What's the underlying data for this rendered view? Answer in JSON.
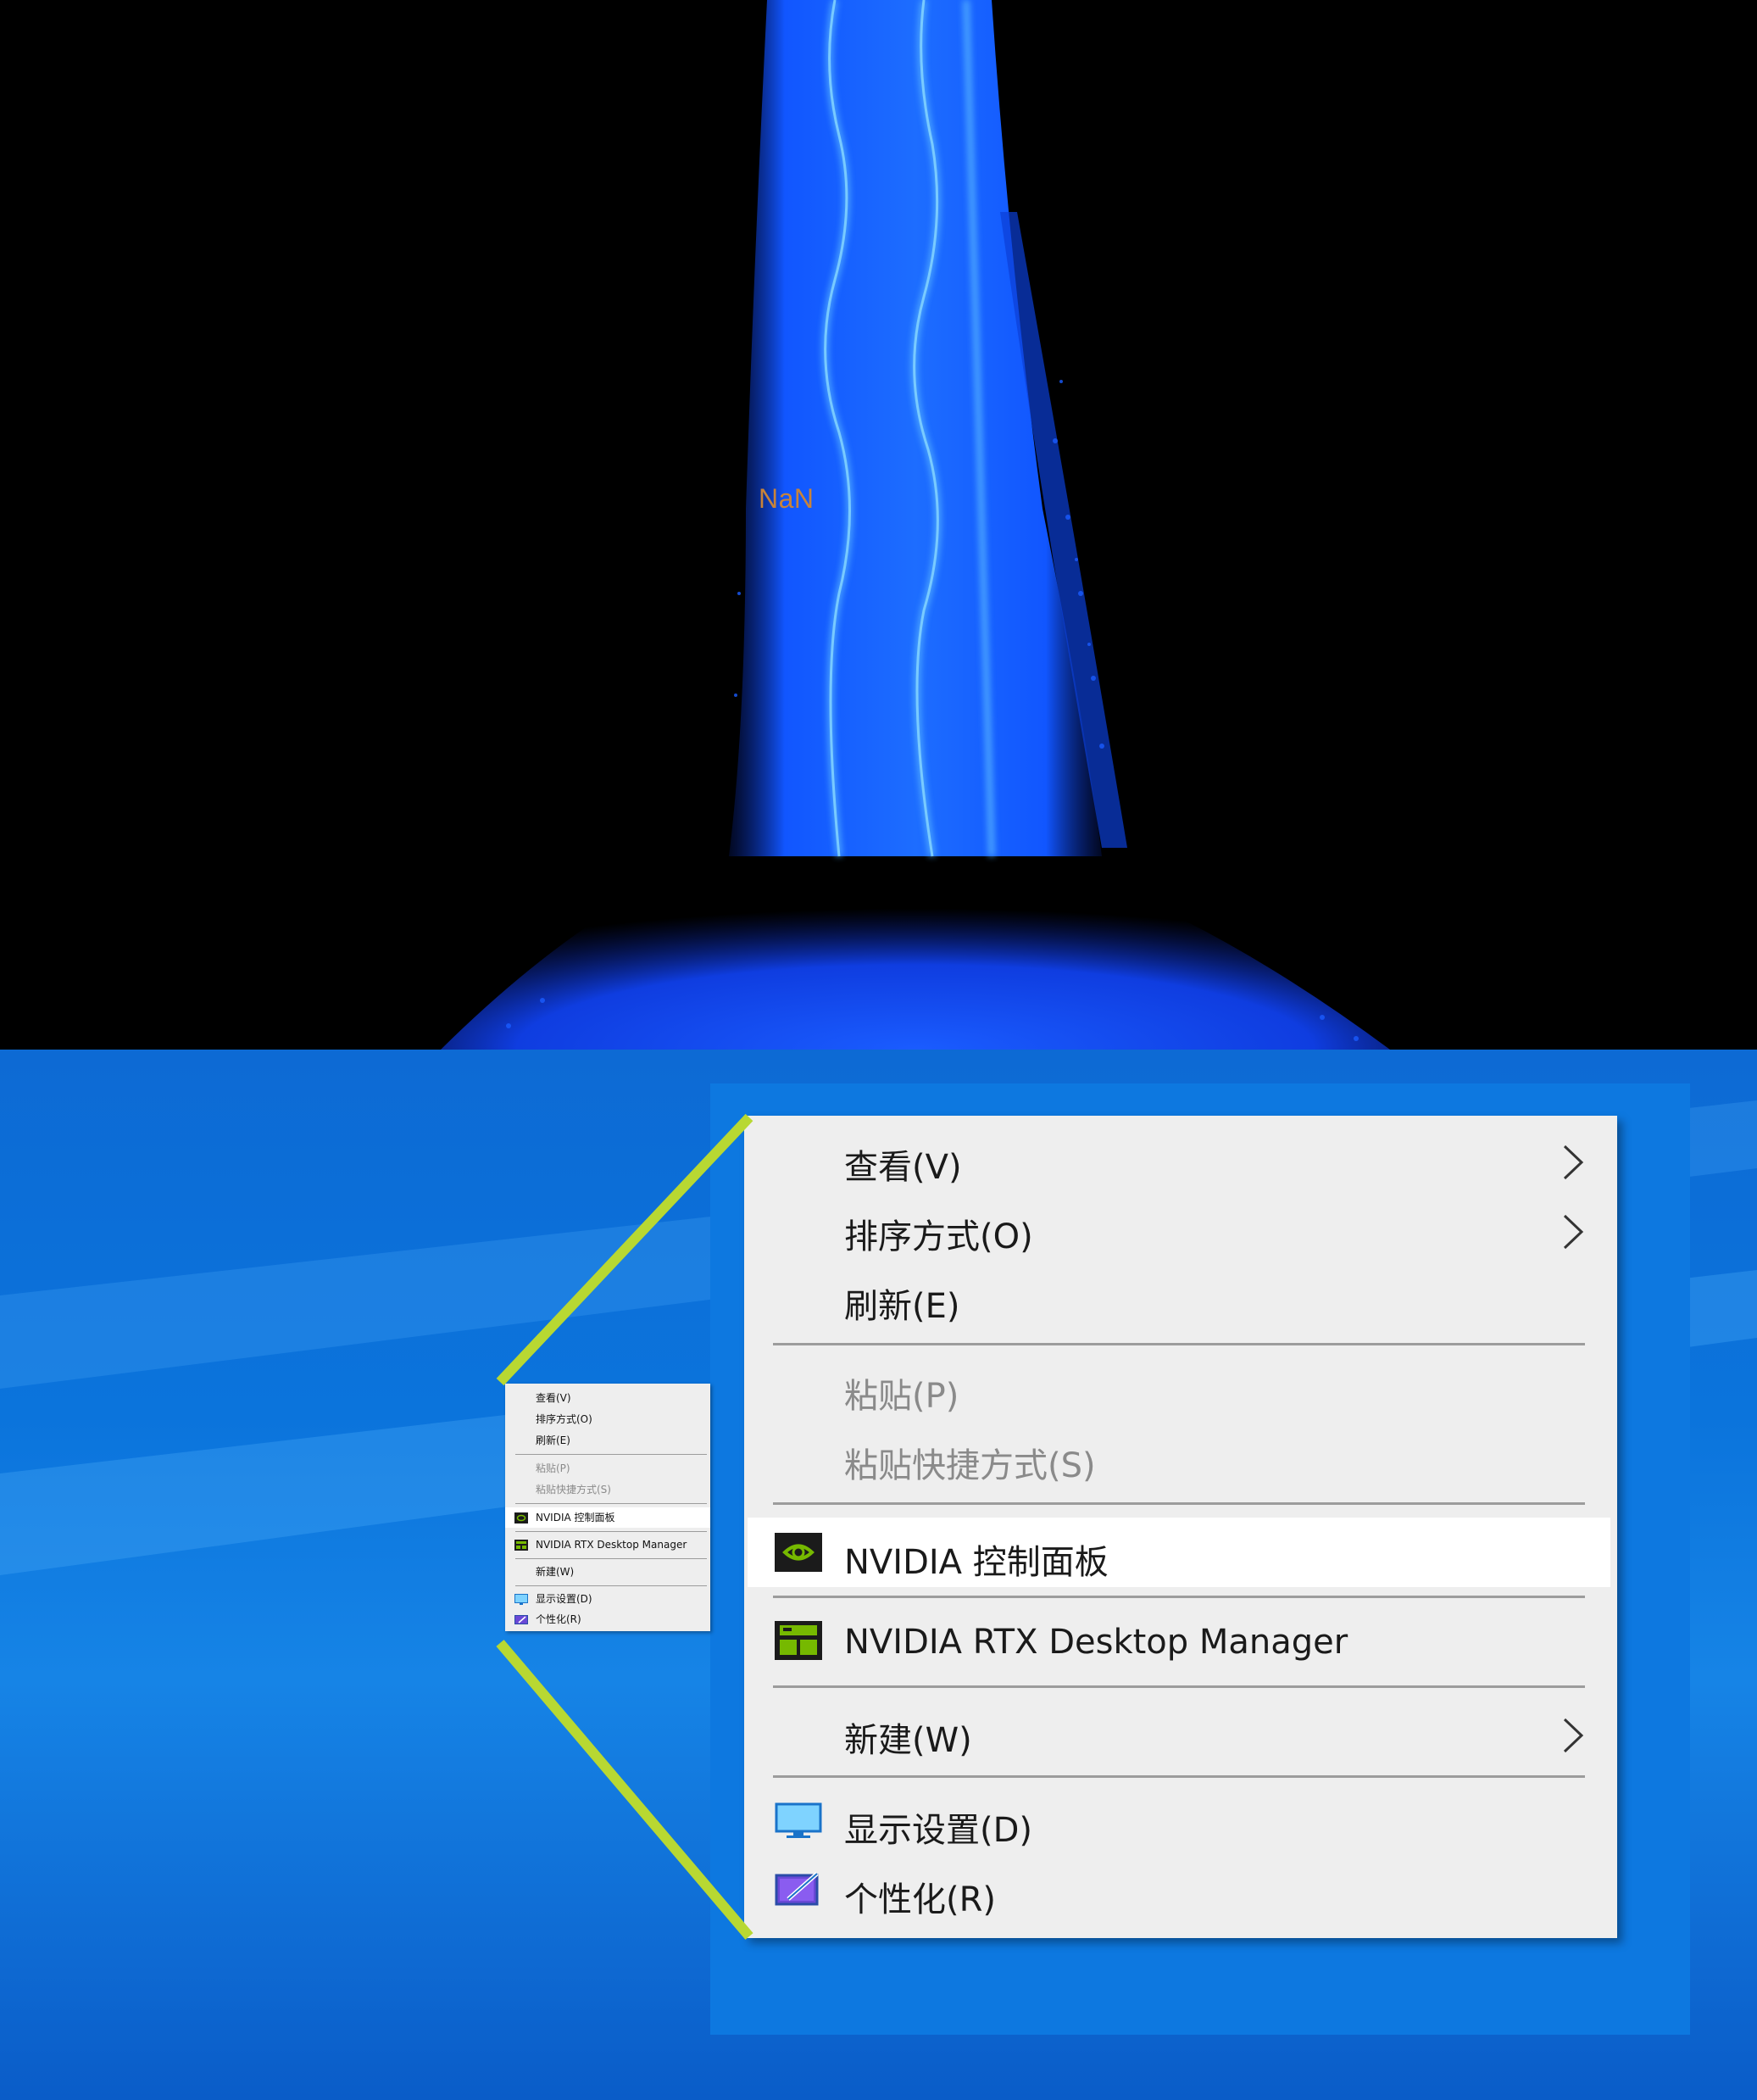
{
  "render": {
    "overlay_text": "NaN",
    "colors": {
      "particles": "#1560ff",
      "highlight": "#5ab8ff",
      "label": "#c8833a"
    }
  },
  "desktop": {
    "colors": {
      "background": "#0b74dc",
      "zoom_lines": "#b8d832"
    }
  },
  "context_menu": {
    "items": [
      {
        "label": "查看(V)",
        "has_submenu": true,
        "icon": ""
      },
      {
        "label": "排序方式(O)",
        "has_submenu": true,
        "icon": ""
      },
      {
        "label": "刷新(E)",
        "has_submenu": false,
        "icon": ""
      },
      {
        "label": "粘贴(P)",
        "disabled": true,
        "icon": ""
      },
      {
        "label": "粘贴快捷方式(S)",
        "disabled": true,
        "icon": ""
      },
      {
        "label": "NVIDIA 控制面板",
        "highlighted": true,
        "icon": "nvidia-logo-icon"
      },
      {
        "label": "NVIDIA RTX Desktop Manager",
        "icon": "rtx-desktop-manager-icon"
      },
      {
        "label": "新建(W)",
        "has_submenu": true,
        "icon": ""
      },
      {
        "label": "显示设置(D)",
        "icon": "display-settings-icon"
      },
      {
        "label": "个性化(R)",
        "icon": "personalize-icon"
      }
    ]
  }
}
